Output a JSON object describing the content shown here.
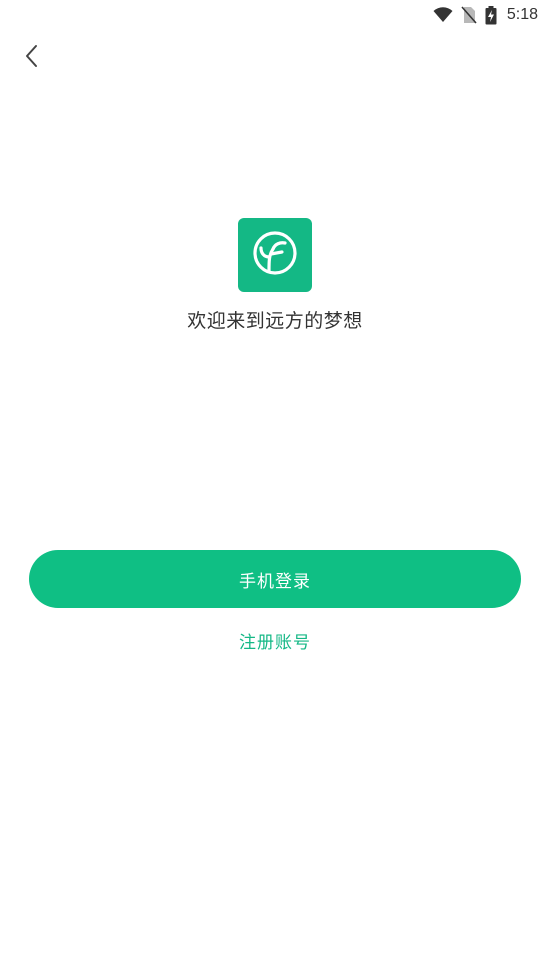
{
  "colors": {
    "brand_green": "#0fbf84",
    "logo_green": "#14b885",
    "link_green": "#15b886",
    "text_dark": "#333333"
  },
  "status_bar": {
    "time": "5:18",
    "icons": [
      "wifi-icon",
      "no-sim-icon",
      "battery-charging-icon"
    ]
  },
  "nav": {
    "back_icon": "chevron-left-icon"
  },
  "logo": {
    "icon": "sprout-icon"
  },
  "welcome": {
    "text": "欢迎来到远方的梦想"
  },
  "actions": {
    "phone_login_label": "手机登录",
    "register_label": "注册账号"
  }
}
